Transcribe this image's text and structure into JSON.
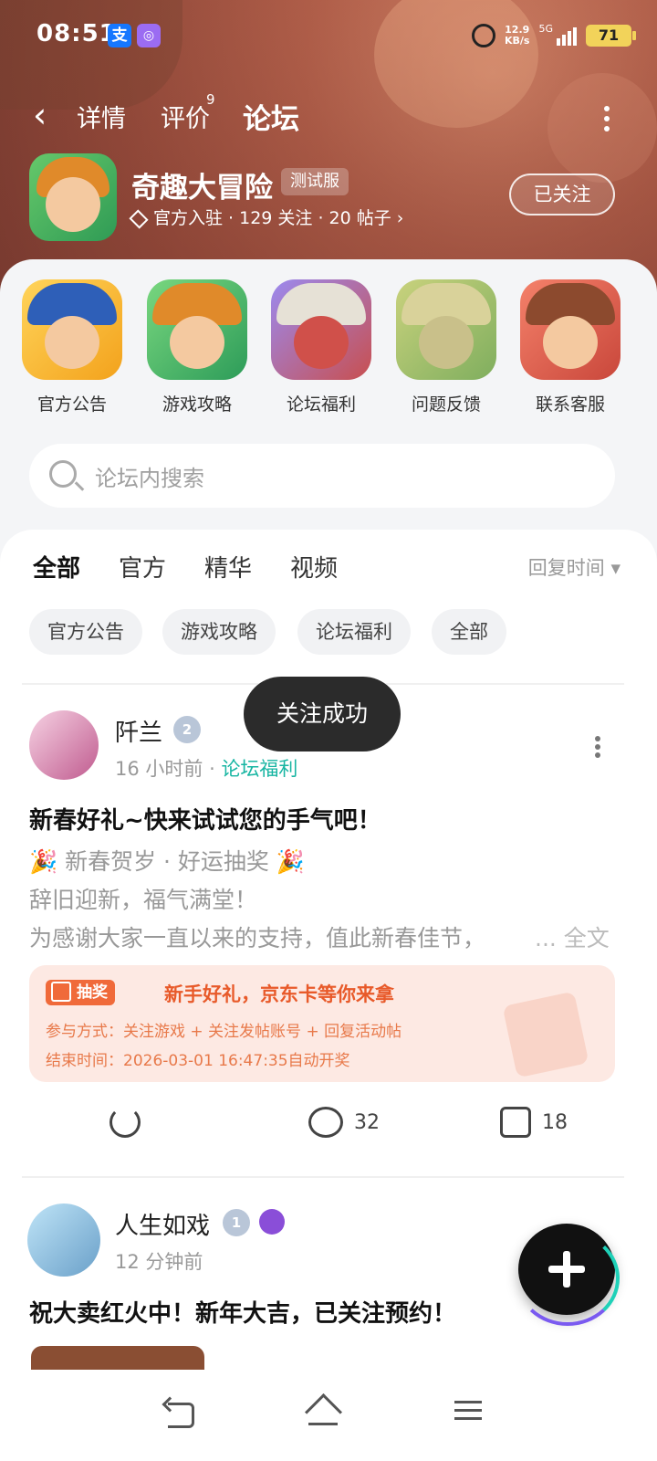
{
  "status_bar": {
    "time": "08:51",
    "app_icons": [
      "alipay-icon",
      "purple-app-icon"
    ],
    "net_speed_value": "12.9",
    "net_speed_unit": "KB/s",
    "network": "5G",
    "battery": "71"
  },
  "nav": {
    "tabs": [
      {
        "label": "详情"
      },
      {
        "label": "评价",
        "badge": "9"
      },
      {
        "label": "论坛",
        "active": true
      }
    ],
    "accent_color": "#1fd1b8"
  },
  "game": {
    "title": "奇趣大冒险",
    "test_badge": "测试服",
    "meta": "官方入驻 · 129 关注 · 20 帖子",
    "follow_label": "已关注"
  },
  "quick_links": [
    {
      "label": "官方公告"
    },
    {
      "label": "游戏攻略"
    },
    {
      "label": "论坛福利"
    },
    {
      "label": "问题反馈"
    },
    {
      "label": "联系客服"
    }
  ],
  "search": {
    "placeholder": "论坛内搜索"
  },
  "content_tabs": [
    {
      "label": "全部",
      "active": true
    },
    {
      "label": "官方"
    },
    {
      "label": "精华"
    },
    {
      "label": "视频"
    }
  ],
  "sort_label": "回复时间 ▾",
  "chips": [
    {
      "label": "官方公告"
    },
    {
      "label": "游戏攻略"
    },
    {
      "label": "论坛福利"
    },
    {
      "label": "全部"
    }
  ],
  "toast": "关注成功",
  "posts": [
    {
      "author": "阡兰",
      "level": "2",
      "time": "16 小时前",
      "tag": "论坛福利",
      "title": "新春好礼~快来试试您的手气吧！",
      "lines": [
        "🎉 新春贺岁 · 好运抽奖 🎉",
        "辞旧迎新，福气满堂！",
        "为感谢大家一直以来的支持，值此新春佳节，"
      ],
      "more_label": "... 全文",
      "lottery": {
        "badge": "抽奖",
        "title": "新手好礼，京东卡等你来拿",
        "rule": "参与方式：关注游戏 + 关注发帖账号 + 回复活动帖",
        "end": "结束时间：2026-03-01 16:47:35自动开奖"
      },
      "comments": "32",
      "likes": "18"
    },
    {
      "author": "人生如戏",
      "level": "1",
      "time": "12 分钟前",
      "title": "祝大卖红火中！新年大吉，已关注预约！"
    }
  ]
}
